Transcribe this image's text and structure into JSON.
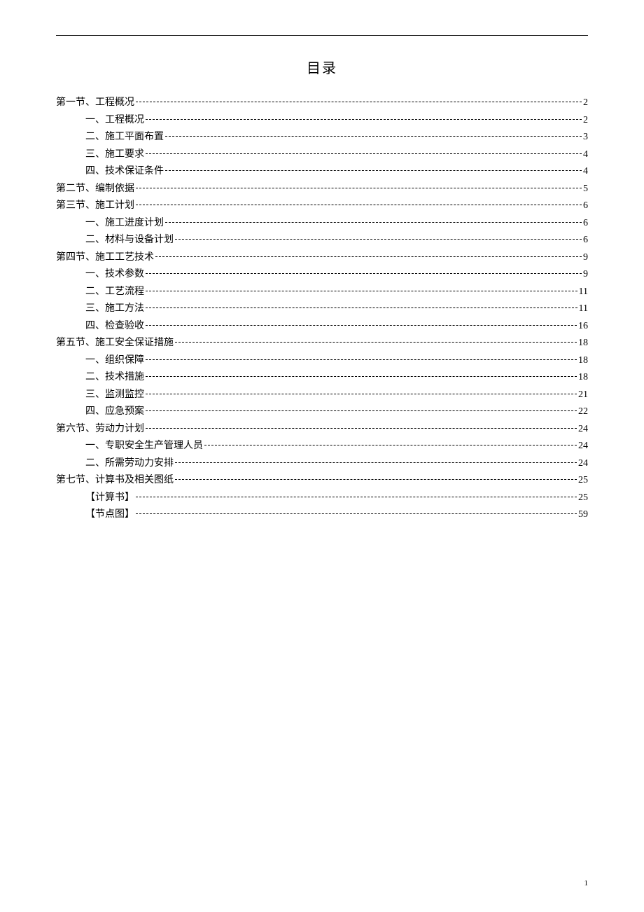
{
  "title": "目录",
  "pageNumber": "1",
  "entries": [
    {
      "level": 1,
      "label": "第一节、工程概况",
      "page": "2"
    },
    {
      "level": 2,
      "label": "一、工程概况",
      "page": "2"
    },
    {
      "level": 2,
      "label": "二、施工平面布置",
      "page": "3"
    },
    {
      "level": 2,
      "label": "三、施工要求",
      "page": "4"
    },
    {
      "level": 2,
      "label": "四、技术保证条件",
      "page": "4"
    },
    {
      "level": 1,
      "label": "第二节、编制依据",
      "page": "5"
    },
    {
      "level": 1,
      "label": "第三节、施工计划",
      "page": "6"
    },
    {
      "level": 2,
      "label": "一、施工进度计划",
      "page": "6"
    },
    {
      "level": 2,
      "label": "二、材料与设备计划",
      "page": "6"
    },
    {
      "level": 1,
      "label": "第四节、施工工艺技术",
      "page": "9"
    },
    {
      "level": 2,
      "label": "一、技术参数",
      "page": "9"
    },
    {
      "level": 2,
      "label": "二、工艺流程",
      "page": "11"
    },
    {
      "level": 2,
      "label": "三、施工方法",
      "page": "11"
    },
    {
      "level": 2,
      "label": "四、检查验收",
      "page": "16"
    },
    {
      "level": 1,
      "label": "第五节、施工安全保证措施",
      "page": "18"
    },
    {
      "level": 2,
      "label": "一、组织保障",
      "page": "18"
    },
    {
      "level": 2,
      "label": "二、技术措施",
      "page": "18"
    },
    {
      "level": 2,
      "label": "三、监测监控",
      "page": "21"
    },
    {
      "level": 2,
      "label": "四、应急预案",
      "page": "22"
    },
    {
      "level": 1,
      "label": "第六节、劳动力计划",
      "page": "24"
    },
    {
      "level": 2,
      "label": "一、专职安全生产管理人员",
      "page": "24"
    },
    {
      "level": 2,
      "label": "二、所需劳动力安排",
      "page": "24"
    },
    {
      "level": 1,
      "label": "第七节、计算书及相关图纸",
      "page": "25"
    },
    {
      "level": 2,
      "label": "【计算书】",
      "page": "25"
    },
    {
      "level": 2,
      "label": "【节点图】",
      "page": "59"
    }
  ]
}
